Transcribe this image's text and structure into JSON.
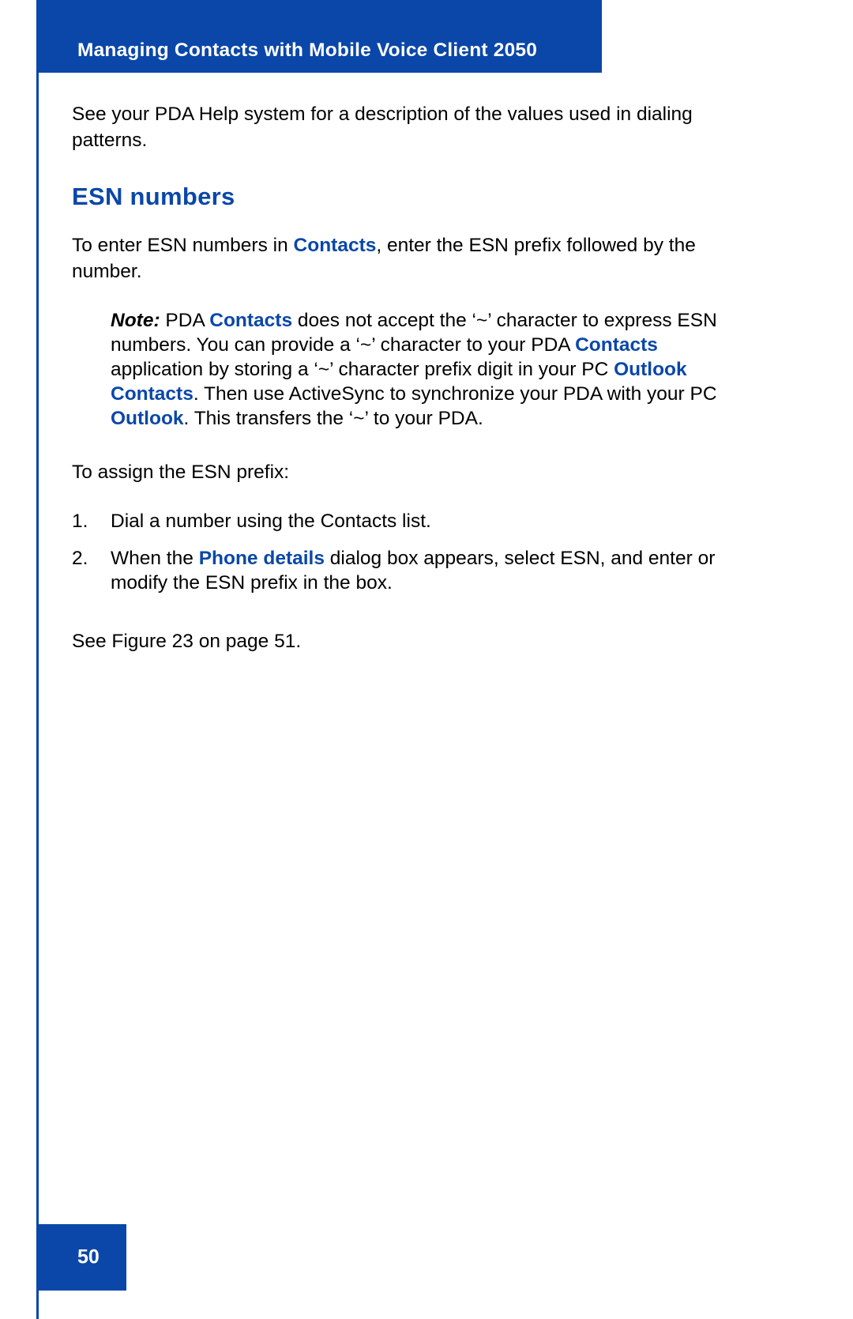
{
  "document": {
    "header": {
      "title": "Managing Contacts with Mobile Voice Client 2050"
    },
    "footer": {
      "page_number": "50"
    },
    "colors": {
      "brand_blue": "#0a47a9",
      "body_text": "#000000",
      "page_background": "#ffffff"
    },
    "body": {
      "intro_paragraph": "See your PDA Help system for a description of the values used in dialing patterns.",
      "section_heading": "ESN numbers",
      "paragraph_1": {
        "part_1": "To enter ESN numbers in ",
        "keyword_1": "Contacts",
        "part_2": ", enter the ESN prefix followed by the number."
      },
      "note": {
        "label": "Note:",
        "part_1": " PDA ",
        "keyword_1": "Contacts",
        "part_2": " does not accept the ‘~’ character to express ESN numbers. You can provide a ‘~’ character to your PDA ",
        "keyword_2": "Contacts",
        "part_3": " application by storing a ‘~’ character prefix digit in your PC ",
        "keyword_3": "Outlook Contacts",
        "part_4": ". Then use ActiveSync to synchronize your PDA with your PC ",
        "keyword_4": "Outlook",
        "part_5": ". This transfers the ‘~’ to your PDA."
      },
      "lead_in": "To assign the ESN prefix:",
      "steps": [
        {
          "number": "1.",
          "part_1": "Dial a number using the Contacts list.",
          "keyword": "",
          "part_2": ""
        },
        {
          "number": "2.",
          "part_1": "When the ",
          "keyword": "Phone details",
          "part_2": " dialog box appears, select ESN, and enter or modify the ESN prefix in the box."
        }
      ],
      "figure_reference": "See Figure 23 on page 51."
    }
  }
}
